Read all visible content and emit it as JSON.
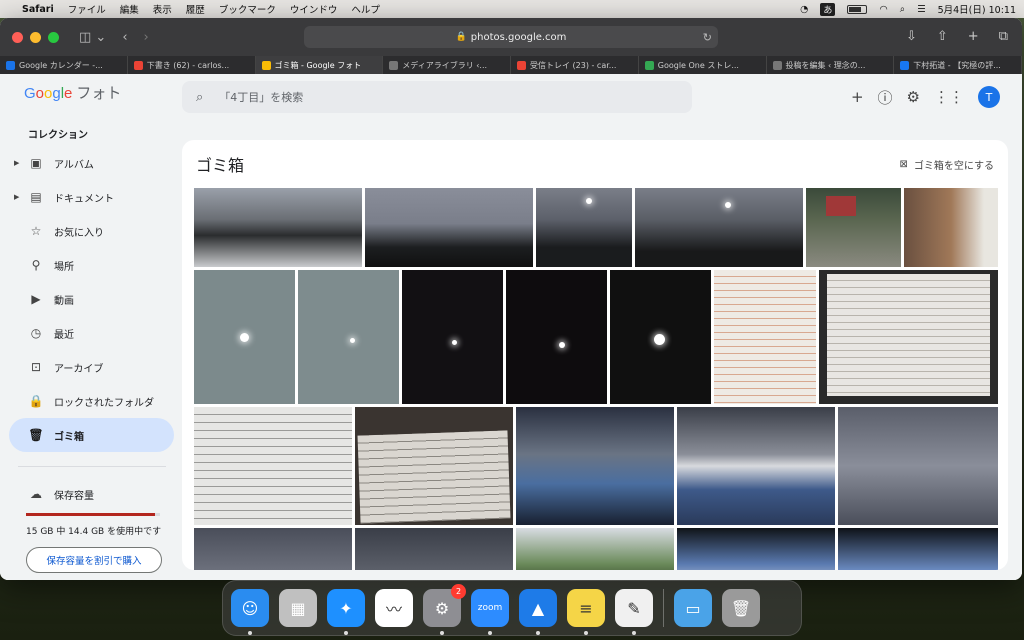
{
  "menubar": {
    "items": [
      "Safari",
      "ファイル",
      "編集",
      "表示",
      "履歴",
      "ブックマーク",
      "ウインドウ",
      "ヘルプ"
    ],
    "ime": "あ",
    "datetime": "5月4日(日)  10:11"
  },
  "browser": {
    "url": "photos.google.com",
    "tabs": [
      {
        "label": "Google カレンダー -...",
        "color": "#1a73e8"
      },
      {
        "label": "下書き (62) - carlos...",
        "color": "#ea4335"
      },
      {
        "label": "ゴミ箱 - Google フォト",
        "color": "#fbbc05"
      },
      {
        "label": "メディアライブラリ ‹...",
        "color": "#777777"
      },
      {
        "label": "受信トレイ (23) - car...",
        "color": "#ea4335"
      },
      {
        "label": "Google One ストレ...",
        "color": "#34a853"
      },
      {
        "label": "投稿を編集 ‹ 理念の...",
        "color": "#777777"
      },
      {
        "label": "下村拓道 - 【究極の評...",
        "color": "#1877f2"
      }
    ],
    "active_tab": 2
  },
  "header": {
    "logo_google": [
      "G",
      "o",
      "o",
      "g",
      "l",
      "e"
    ],
    "logo_product": "フォト",
    "search_placeholder": "「4丁目」を検索",
    "avatar_letter": "T"
  },
  "sidebar": {
    "title": "コレクション",
    "items": [
      {
        "label": "アルバム",
        "icon": "album-icon",
        "glyph": "▣",
        "caret": true
      },
      {
        "label": "ドキュメント",
        "icon": "document-icon",
        "glyph": "▤",
        "caret": true
      },
      {
        "label": "お気に入り",
        "icon": "star-icon",
        "glyph": "☆",
        "caret": false
      },
      {
        "label": "場所",
        "icon": "location-icon",
        "glyph": "⚲",
        "caret": false
      },
      {
        "label": "動画",
        "icon": "video-icon",
        "glyph": "▶",
        "caret": false
      },
      {
        "label": "最近",
        "icon": "clock-icon",
        "glyph": "◷",
        "caret": false
      },
      {
        "label": "アーカイブ",
        "icon": "archive-icon",
        "glyph": "⊡",
        "caret": false
      },
      {
        "label": "ロックされたフォルダ",
        "icon": "lock-icon",
        "glyph": "🔒",
        "caret": false
      },
      {
        "label": "ゴミ箱",
        "icon": "trash-icon",
        "glyph": "🗑",
        "caret": false,
        "active": true
      }
    ],
    "storage_label": "保存容量",
    "storage_used_fraction": 0.96,
    "storage_text": "15 GB 中 14.4 GB を使用中です",
    "buy_label": "保存容量を割引で購入"
  },
  "main": {
    "title": "ゴミ箱",
    "empty_label": "ゴミ箱を空にする"
  },
  "colors": {
    "accent": "#1a73e8",
    "active_nav": "#d3e3fd",
    "storage_fill": "#b3261e"
  },
  "dock": {
    "apps": [
      {
        "name": "finder-icon",
        "bg": "#2a8cf0",
        "glyph": "☺",
        "dot": true
      },
      {
        "name": "launchpad-icon",
        "bg": "#c0c0c0",
        "glyph": "▦",
        "dot": false
      },
      {
        "name": "safari-icon",
        "bg": "#1e90ff",
        "glyph": "✦",
        "dot": true
      },
      {
        "name": "freeform-icon",
        "bg": "#ffffff",
        "glyph": "〰",
        "dot": false
      },
      {
        "name": "system-settings-icon",
        "bg": "#8e8e93",
        "glyph": "⚙",
        "dot": true,
        "badge": "2"
      },
      {
        "name": "zoom-icon",
        "bg": "#2d8cff",
        "glyph": "zoom",
        "dot": true
      },
      {
        "name": "keynote-icon",
        "bg": "#1e7be8",
        "glyph": "▲",
        "dot": true
      },
      {
        "name": "notes-icon",
        "bg": "#f5d547",
        "glyph": "≡",
        "dot": true
      },
      {
        "name": "textedit-icon",
        "bg": "#f0f0f0",
        "glyph": "✎",
        "dot": true
      },
      {
        "name": "folder-icon",
        "bg": "#4aa3e8",
        "glyph": "▭",
        "dot": false
      },
      {
        "name": "trash-dock-icon",
        "bg": "#9a9a9a",
        "glyph": "🗑",
        "dot": false
      }
    ]
  }
}
